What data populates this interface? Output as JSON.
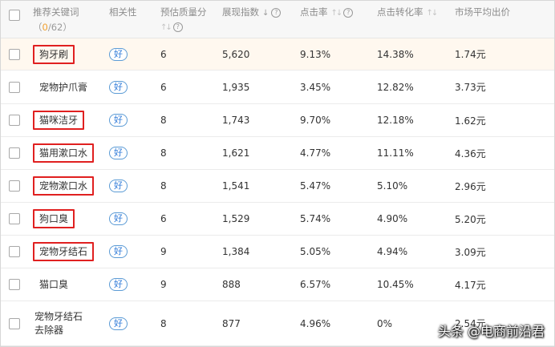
{
  "headers": {
    "keyword": "推荐关键词",
    "selected_open": "（",
    "selected_count": "0",
    "selected_total": "/62）",
    "relevance": "相关性",
    "quality": "预估质量分",
    "impressions": "展现指数",
    "ctr": "点击率",
    "cvr": "点击转化率",
    "avg_bid": "市场平均出价"
  },
  "rows": [
    {
      "keyword": "狗牙刷",
      "relevance": "好",
      "quality": "6",
      "impressions": "5,620",
      "ctr": "9.13%",
      "cvr": "14.38%",
      "bid": "1.74元",
      "boxed": true
    },
    {
      "keyword": "宠物护爪膏",
      "relevance": "好",
      "quality": "6",
      "impressions": "1,935",
      "ctr": "3.45%",
      "cvr": "12.82%",
      "bid": "3.73元",
      "boxed": false
    },
    {
      "keyword": "猫咪洁牙",
      "relevance": "好",
      "quality": "8",
      "impressions": "1,743",
      "ctr": "9.70%",
      "cvr": "12.18%",
      "bid": "1.62元",
      "boxed": true
    },
    {
      "keyword": "猫用漱口水",
      "relevance": "好",
      "quality": "8",
      "impressions": "1,621",
      "ctr": "4.77%",
      "cvr": "11.11%",
      "bid": "4.36元",
      "boxed": true
    },
    {
      "keyword": "宠物漱口水",
      "relevance": "好",
      "quality": "8",
      "impressions": "1,541",
      "ctr": "5.47%",
      "cvr": "5.10%",
      "bid": "2.96元",
      "boxed": true
    },
    {
      "keyword": "狗口臭",
      "relevance": "好",
      "quality": "6",
      "impressions": "1,529",
      "ctr": "5.74%",
      "cvr": "4.90%",
      "bid": "5.20元",
      "boxed": true
    },
    {
      "keyword": "宠物牙结石",
      "relevance": "好",
      "quality": "9",
      "impressions": "1,384",
      "ctr": "5.05%",
      "cvr": "4.94%",
      "bid": "3.09元",
      "boxed": true
    },
    {
      "keyword": "猫口臭",
      "relevance": "好",
      "quality": "9",
      "impressions": "888",
      "ctr": "6.57%",
      "cvr": "10.45%",
      "bid": "4.17元",
      "boxed": false
    },
    {
      "keyword": "宠物牙结石去除器",
      "relevance": "好",
      "quality": "8",
      "impressions": "877",
      "ctr": "4.96%",
      "cvr": "0%",
      "bid": "2.54元",
      "boxed": false
    }
  ],
  "watermark": "头条 @电商前沿君",
  "colors": {
    "highlight_box": "#e02020",
    "badge_blue": "#2f7bd9",
    "first_row_bg": "#fff8ef",
    "count_orange": "#f0a030"
  }
}
